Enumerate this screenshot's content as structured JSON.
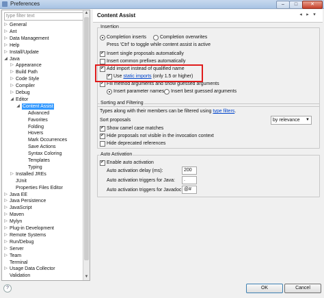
{
  "window": {
    "title": "Preferences",
    "minimize": "–",
    "maximize": "□",
    "close": "✕"
  },
  "filter": {
    "placeholder": "type filter text"
  },
  "tree": [
    {
      "label": "General",
      "arrow": "▷"
    },
    {
      "label": "Ant",
      "arrow": "▷"
    },
    {
      "label": "Data Management",
      "arrow": "▷"
    },
    {
      "label": "Help",
      "arrow": "▷"
    },
    {
      "label": "Install/Update",
      "arrow": "▷"
    },
    {
      "label": "Java",
      "arrow": "◢"
    },
    {
      "label": "Appearance",
      "arrow": "▷"
    },
    {
      "label": "Build Path",
      "arrow": "▷"
    },
    {
      "label": "Code Style",
      "arrow": "▷"
    },
    {
      "label": "Compiler",
      "arrow": "▷"
    },
    {
      "label": "Debug",
      "arrow": "▷"
    },
    {
      "label": "Editor",
      "arrow": "◢"
    },
    {
      "label": "Content Assist",
      "arrow": "◢"
    },
    {
      "label": "Advanced",
      "arrow": ""
    },
    {
      "label": "Favorites",
      "arrow": ""
    },
    {
      "label": "Folding",
      "arrow": ""
    },
    {
      "label": "Hovers",
      "arrow": ""
    },
    {
      "label": "Mark Occurrences",
      "arrow": ""
    },
    {
      "label": "Save Actions",
      "arrow": ""
    },
    {
      "label": "Syntax Coloring",
      "arrow": ""
    },
    {
      "label": "Templates",
      "arrow": ""
    },
    {
      "label": "Typing",
      "arrow": ""
    },
    {
      "label": "Installed JREs",
      "arrow": "▷"
    },
    {
      "label": "JUnit",
      "arrow": ""
    },
    {
      "label": "Properties Files Editor",
      "arrow": ""
    },
    {
      "label": "Java EE",
      "arrow": "▷"
    },
    {
      "label": "Java Persistence",
      "arrow": "▷"
    },
    {
      "label": "JavaScript",
      "arrow": "▷"
    },
    {
      "label": "Maven",
      "arrow": "▷"
    },
    {
      "label": "Mylyn",
      "arrow": "▷"
    },
    {
      "label": "Plug-in Development",
      "arrow": "▷"
    },
    {
      "label": "Remote Systems",
      "arrow": "▷"
    },
    {
      "label": "Run/Debug",
      "arrow": "▷"
    },
    {
      "label": "Server",
      "arrow": "▷"
    },
    {
      "label": "Team",
      "arrow": "▷"
    },
    {
      "label": "Terminal",
      "arrow": ""
    },
    {
      "label": "Usage Data Collector",
      "arrow": "▷"
    },
    {
      "label": "Validation",
      "arrow": ""
    }
  ],
  "scroll": {
    "up": "▲",
    "down": "▼"
  },
  "page": {
    "title": "Content Assist",
    "back": "◂",
    "fwd": "▸",
    "menu": "▾"
  },
  "insertion": {
    "title": "Insertion",
    "completion_inserts": "Completion inserts",
    "completion_overwrites": "Completion overwrites",
    "hint": "Press 'Ctrl' to toggle while content assist is active",
    "insert_single": "Insert single proposals automatically",
    "insert_common_prefixes": "Insert common prefixes automatically",
    "add_import": "Add import instead of qualified name",
    "use_prefix": "Use",
    "static_imports_link": "static imports",
    "use_suffix": "(only 1.5 or higher)",
    "fill_method_args": "Fill method arguments and show guessed arguments",
    "insert_param_names": "Insert parameter names",
    "insert_best_guessed": "Insert best guessed arguments"
  },
  "sorting": {
    "title": "Sorting and Filtering",
    "types_prefix": "Types along with their members can be filtered using",
    "type_filters_link": "type filters",
    "types_suffix": ".",
    "sort_label": "Sort proposals",
    "sort_value": "by relevance",
    "show_camel": "Show camel case matches",
    "hide_not_visible": "Hide proposals not visible in the invocation context",
    "hide_deprecated": "Hide deprecated references"
  },
  "auto": {
    "title": "Auto Activation",
    "enable": "Enable auto activation",
    "delay_label": "Auto activation delay (ms):",
    "delay_value": "200",
    "java_label": "Auto activation triggers for Java:",
    "java_value": ".",
    "javadoc_label": "Auto activation triggers for Javadoc:",
    "javadoc_value": "@#"
  },
  "buttons": {
    "help": "?",
    "ok": "OK",
    "cancel": "Cancel"
  },
  "colors": {
    "highlight": "#e01b1b",
    "selection": "#3399ff",
    "link": "#0044cc"
  }
}
